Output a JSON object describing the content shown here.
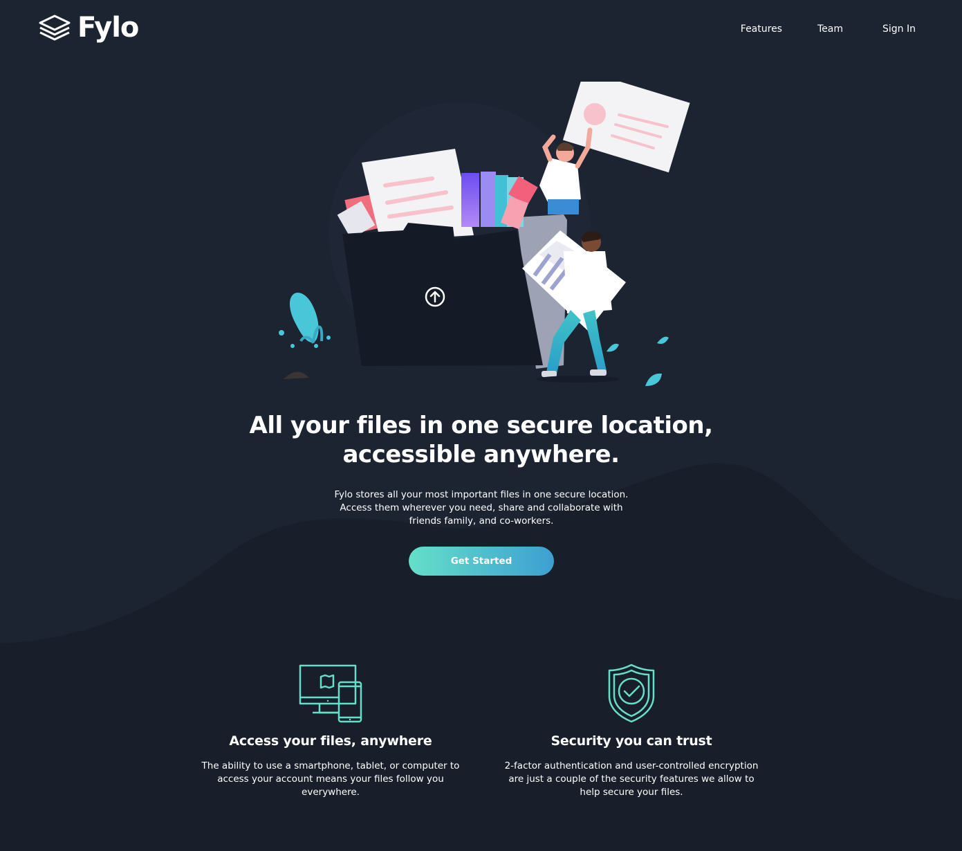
{
  "brand": {
    "name": "Fylo",
    "logo_icon": "stacked-layers-icon"
  },
  "nav": {
    "features": "Features",
    "team": "Team",
    "sign_in": "Sign In"
  },
  "hero": {
    "illustration": "person-carrying-files-folder-illustration",
    "upload_icon": "upload-arrow-icon",
    "title_line1": "All your files in one secure location,",
    "title_line2": "accessible anywhere.",
    "description": "Fylo stores all your most important files in one secure location. Access them wherever you need, share and collaborate with friends family, and co-workers.",
    "cta_label": "Get Started"
  },
  "features": [
    {
      "icon": "devices-icon",
      "title": "Access your files, anywhere",
      "description": "The ability to use a smartphone, tablet, or computer to access your account means your files follow you everywhere."
    },
    {
      "icon": "shield-check-icon",
      "title": "Security you can trust",
      "description": "2-factor authentication and user-controlled encryption are just a couple of the security features we allow to help secure your files."
    }
  ],
  "colors": {
    "background": "#1c2331",
    "curve": "#181f2a",
    "cta_gradient_start": "#65dfc9",
    "cta_gradient_end": "#3d9fd1",
    "icon_accent": "#65dfc9",
    "text": "#ffffff"
  }
}
